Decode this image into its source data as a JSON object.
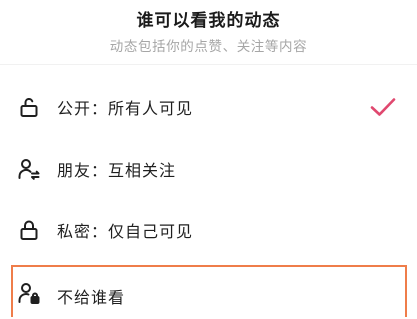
{
  "header": {
    "title": "谁可以看我的动态",
    "subtitle": "动态包括你的点赞、关注等内容"
  },
  "options": [
    {
      "label": "公开：所有人可见",
      "icon": "unlock-icon",
      "selected": true
    },
    {
      "label": "朋友：互相关注",
      "icon": "mutual-follow-icon",
      "selected": false
    },
    {
      "label": "私密：仅自己可见",
      "icon": "lock-icon",
      "selected": false
    },
    {
      "label": "不给谁看",
      "icon": "user-lock-icon",
      "selected": false,
      "highlighted": true
    }
  ],
  "colors": {
    "check": "#e0486f",
    "highlight_border": "#ef7d4a",
    "title": "#1b1b1b",
    "subtitle": "#a6a6a6"
  }
}
